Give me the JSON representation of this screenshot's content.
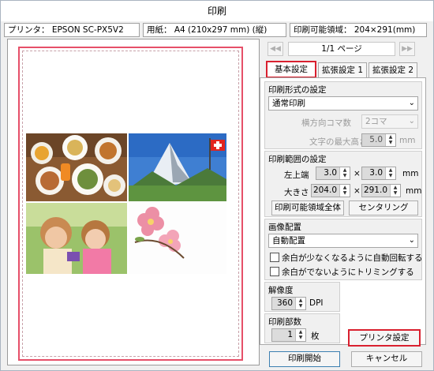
{
  "window": {
    "title": "印刷"
  },
  "info": {
    "printer": "プリンタ： EPSON SC-PX5V2",
    "paper": "用紙： A4 (210x297 mm) (縦)",
    "printable_area": "印刷可能領域： 204×291(mm)"
  },
  "pagenav": {
    "page_label": "1/1 ページ",
    "prev_icon": "◀◀",
    "next_icon": "▶▶"
  },
  "tabs": [
    "基本設定",
    "拡張設定 1",
    "拡張設定 2"
  ],
  "print_format": {
    "title": "印刷形式の設定",
    "mode": "通常印刷",
    "frames_label": "横方向コマ数",
    "frames_value": "2コマ",
    "max_text_height_label": "文字の最大高さ",
    "max_text_height_value": "5.0",
    "max_text_height_unit": "mm"
  },
  "print_range": {
    "title": "印刷範囲の設定",
    "top_left_label": "左上端",
    "top_left_x": "3.0",
    "top_left_y": "3.0",
    "size_label": "大きさ",
    "size_w": "204.0",
    "size_h": "291.0",
    "times": "×",
    "unit": "mm",
    "full_area_button": "印刷可能領域全体",
    "center_button": "センタリング"
  },
  "placement": {
    "title": "画像配置",
    "mode": "自動配置",
    "auto_rotate_label": "余白が少なくなるように自動回転する",
    "auto_rotate_checked": false,
    "trim_label": "余白がでないようにトリミングする",
    "trim_checked": false
  },
  "resolution": {
    "title": "解像度",
    "value": "360",
    "unit": "DPI"
  },
  "copies": {
    "title": "印刷部数",
    "value": "1",
    "unit": "枚"
  },
  "buttons": {
    "printer_settings": "プリンタ設定",
    "print": "印刷開始",
    "cancel": "キャンセル"
  },
  "colors": {
    "highlight": "#d9202f",
    "paper_border": "#e65069"
  }
}
